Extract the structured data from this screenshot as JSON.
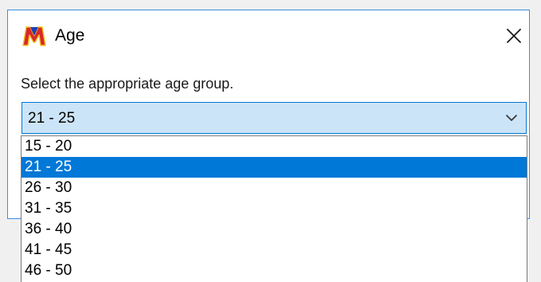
{
  "dialog": {
    "title": "Age",
    "app_icon_name": "m-logo-icon",
    "close_icon_name": "close-icon",
    "prompt": "Select the appropriate age group."
  },
  "combo": {
    "selected": "21 - 25",
    "chevron_icon_name": "chevron-down-icon"
  },
  "options": [
    {
      "label": "15 - 20",
      "selected": false
    },
    {
      "label": "21 - 25",
      "selected": true
    },
    {
      "label": "26 - 30",
      "selected": false
    },
    {
      "label": "31 - 35",
      "selected": false
    },
    {
      "label": "36 - 40",
      "selected": false
    },
    {
      "label": "41 - 45",
      "selected": false
    },
    {
      "label": "46 - 50",
      "selected": false
    }
  ],
  "colors": {
    "accent": "#0078d7",
    "combo_background": "#cce4f7",
    "dialog_border": "#3a8ee6",
    "logo_red": "#d9262b",
    "logo_blue": "#1f3fb5",
    "logo_yellow": "#f3c21c"
  }
}
